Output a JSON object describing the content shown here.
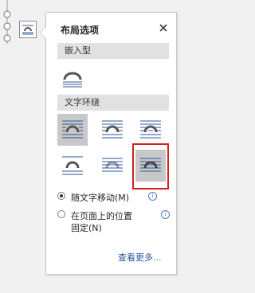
{
  "pane": {
    "title": "布局选项",
    "close_icon": "close-icon"
  },
  "inline": {
    "header": "嵌入型",
    "options": [
      {
        "name": "inline-with-text",
        "icon": "wrap-inline-icon"
      }
    ]
  },
  "wrap": {
    "header": "文字环绕",
    "options": [
      {
        "name": "square",
        "icon": "wrap-square-icon",
        "active": true
      },
      {
        "name": "tight",
        "icon": "wrap-tight-icon"
      },
      {
        "name": "through",
        "icon": "wrap-through-icon"
      },
      {
        "name": "top-and-bottom",
        "icon": "wrap-top-bottom-icon"
      },
      {
        "name": "behind-text",
        "icon": "wrap-behind-icon"
      },
      {
        "name": "in-front-of-text",
        "icon": "wrap-in-front-icon",
        "highlighted": true
      }
    ]
  },
  "position": {
    "move_with_text": "随文字移动(M)",
    "fix_on_page_line1": "在页面上的位置",
    "fix_on_page_line2": "固定(N)",
    "selected": "move_with_text"
  },
  "see_more": "查看更多..."
}
